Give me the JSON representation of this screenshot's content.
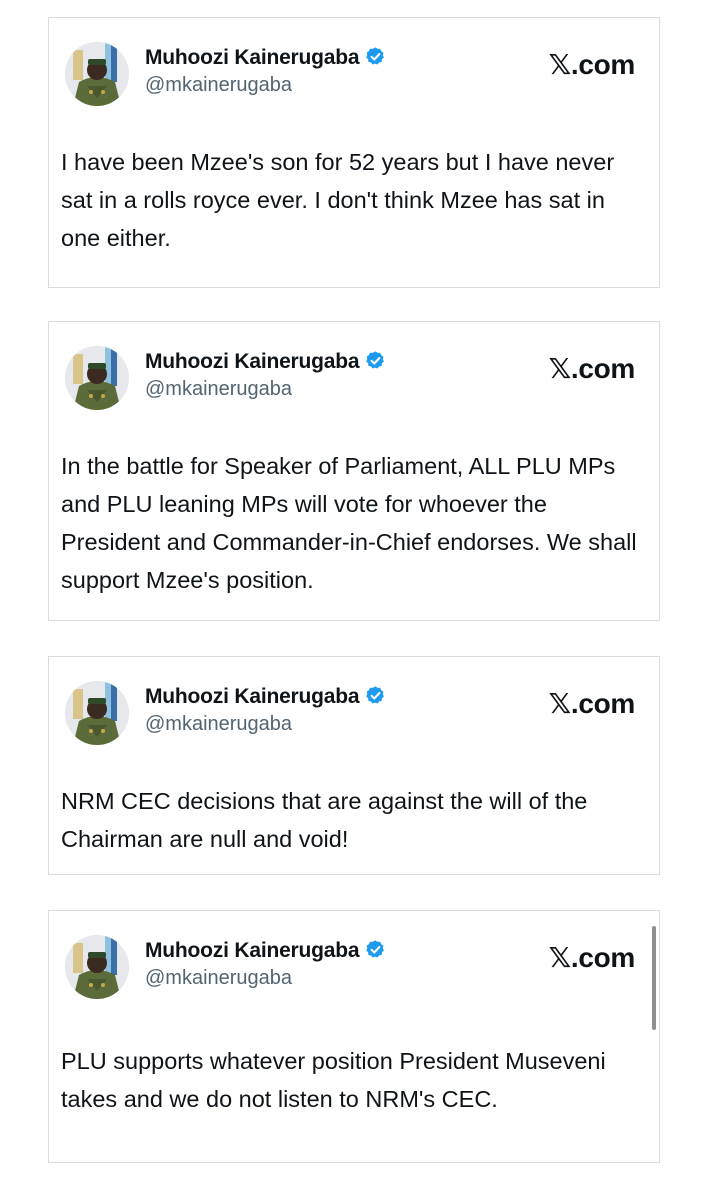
{
  "tweets": [
    {
      "author_name": "Muhoozi Kainerugaba",
      "handle": "@mkainerugaba",
      "source": "𝕏.com",
      "text": "I have been Mzee's son for 52 years but I have never sat in a rolls royce ever. I don't think Mzee has sat in one either."
    },
    {
      "author_name": "Muhoozi Kainerugaba",
      "handle": "@mkainerugaba",
      "source": "𝕏.com",
      "text": "In the battle for Speaker of Parliament, ALL PLU MPs and PLU leaning MPs will vote for whoever the President and Commander-in-Chief endorses. We shall support Mzee's position."
    },
    {
      "author_name": "Muhoozi Kainerugaba",
      "handle": "@mkainerugaba",
      "source": "𝕏.com",
      "text": "NRM CEC decisions that are against the will of the Chairman are null and void!"
    },
    {
      "author_name": "Muhoozi Kainerugaba",
      "handle": "@mkainerugaba",
      "source": "𝕏.com",
      "text": "PLU supports whatever position President Museveni takes and we do not listen to NRM's CEC."
    }
  ],
  "colors": {
    "verified_badge": "#1d9bf0",
    "name_text": "#0f1419",
    "handle_text": "#536471",
    "card_border": "#dcdcdc"
  },
  "icons": {
    "verified": "verified-badge-icon",
    "avatar": "profile-avatar"
  }
}
